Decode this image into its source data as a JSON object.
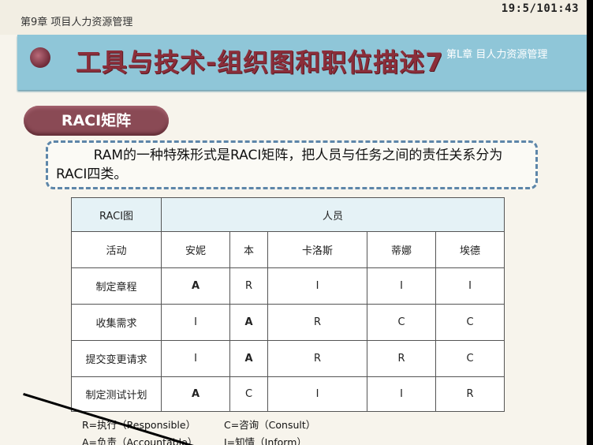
{
  "header": {
    "chapter": "第9章 项目人力资源管理",
    "clock": "19:5/101:43"
  },
  "banner": {
    "title": "工具与技术-组织图和职位描述7",
    "subtitle": "第L章 目人力资源管理"
  },
  "section": {
    "pill_label": "RACI矩阵"
  },
  "description": "RAM的一种特殊形式是RACI矩阵，把人员与任务之间的责任关系分为RACI四类。",
  "table": {
    "corner": "RACI图",
    "people_header": "人员",
    "activity_header": "活动",
    "people": [
      "安妮",
      "本",
      "卡洛斯",
      "蒂娜",
      "埃德"
    ],
    "rows": [
      {
        "activity": "制定章程",
        "cells": [
          "A",
          "R",
          "I",
          "I",
          "I"
        ]
      },
      {
        "activity": "收集需求",
        "cells": [
          "I",
          "A",
          "R",
          "C",
          "C"
        ]
      },
      {
        "activity": "提交变更请求",
        "cells": [
          "I",
          "A",
          "R",
          "R",
          "C"
        ]
      },
      {
        "activity": "制定测试计划",
        "cells": [
          "A",
          "C",
          "I",
          "I",
          "R"
        ]
      }
    ]
  },
  "legend": {
    "r": "R=执行（Responsible）",
    "c": "C=咨询（Consult）",
    "a": "A=负责（Accountable）",
    "i": "I=知情（Inform）"
  }
}
